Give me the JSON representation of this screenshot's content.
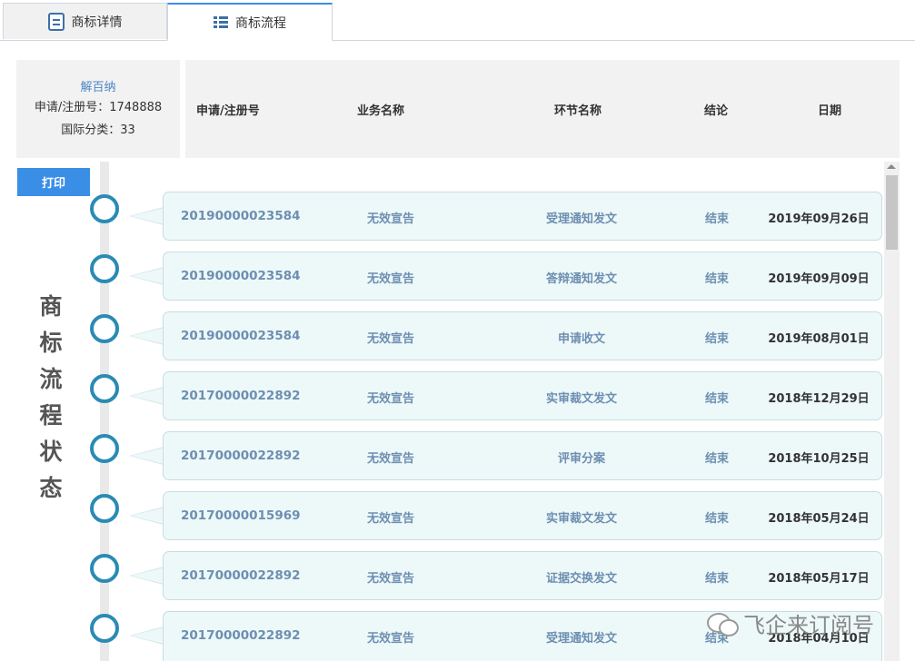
{
  "tabs": [
    {
      "label": "商标详情",
      "icon": "document-icon",
      "active": false
    },
    {
      "label": "商标流程",
      "icon": "list-icon",
      "active": true
    }
  ],
  "info": {
    "owner": "解百纳",
    "reg_line": "申请/注册号：1748888",
    "class_line": "国际分类：33"
  },
  "columns": [
    "申请/注册号",
    "业务名称",
    "环节名称",
    "结论",
    "日期"
  ],
  "print_label": "打印",
  "side_title": [
    "商",
    "标",
    "流",
    "程",
    "状",
    "态"
  ],
  "records": [
    {
      "reg_no": "20190000023584",
      "business": "无效宣告",
      "step": "受理通知发文",
      "result": "结束",
      "date": "2019年09月26日"
    },
    {
      "reg_no": "20190000023584",
      "business": "无效宣告",
      "step": "答辩通知发文",
      "result": "结束",
      "date": "2019年09月09日"
    },
    {
      "reg_no": "20190000023584",
      "business": "无效宣告",
      "step": "申请收文",
      "result": "结束",
      "date": "2019年08月01日"
    },
    {
      "reg_no": "20170000022892",
      "business": "无效宣告",
      "step": "实审裁文发文",
      "result": "结束",
      "date": "2018年12月29日"
    },
    {
      "reg_no": "20170000022892",
      "business": "无效宣告",
      "step": "评审分案",
      "result": "结束",
      "date": "2018年10月25日"
    },
    {
      "reg_no": "20170000015969",
      "business": "无效宣告",
      "step": "实审裁文发文",
      "result": "结束",
      "date": "2018年05月24日"
    },
    {
      "reg_no": "20170000022892",
      "business": "无效宣告",
      "step": "证据交换发文",
      "result": "结束",
      "date": "2018年05月17日"
    },
    {
      "reg_no": "20170000022892",
      "business": "无效宣告",
      "step": "受理通知发文",
      "result": "结束",
      "date": "2018年04月10日"
    }
  ],
  "watermark": "飞企来订阅号",
  "colors": {
    "accent": "#3a8ee6",
    "node": "#2a8bb4",
    "record_bg": "#edf8f9",
    "link_text": "#6d8fb1"
  }
}
